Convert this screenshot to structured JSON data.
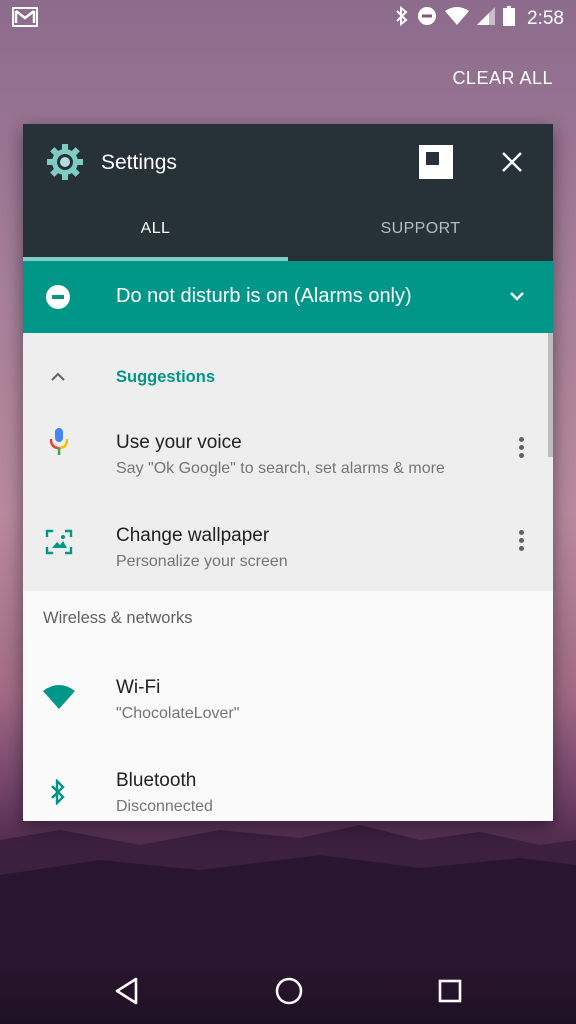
{
  "status_bar": {
    "time": "2:58"
  },
  "recents": {
    "clear_all_label": "CLEAR ALL"
  },
  "card": {
    "app_title": "Settings",
    "tabs": [
      {
        "label": "ALL"
      },
      {
        "label": "SUPPORT"
      }
    ],
    "dnd_banner": "Do not disturb is on (Alarms only)",
    "suggestions": {
      "header": "Suggestions",
      "items": [
        {
          "title": "Use your voice",
          "subtitle": "Say \"Ok Google\" to search, set alarms & more"
        },
        {
          "title": "Change wallpaper",
          "subtitle": "Personalize your screen"
        }
      ]
    },
    "section_header": "Wireless & networks",
    "settings_items": [
      {
        "title": "Wi-Fi",
        "subtitle": "\"ChocolateLover\""
      },
      {
        "title": "Bluetooth",
        "subtitle": "Disconnected"
      }
    ]
  },
  "colors": {
    "accent": "#009688",
    "header_bg": "#263238",
    "tab_indicator": "#80cbc4"
  },
  "icons": [
    "gmail-icon",
    "bluetooth-icon",
    "do-not-disturb-icon",
    "wifi-icon",
    "signal-icon",
    "battery-icon",
    "settings-gear-icon",
    "split-screen-icon",
    "close-icon",
    "chevron-down-icon",
    "chevron-up-icon",
    "microphone-icon",
    "wallpaper-icon",
    "more-vert-icon",
    "back-icon",
    "home-icon",
    "recents-icon"
  ]
}
